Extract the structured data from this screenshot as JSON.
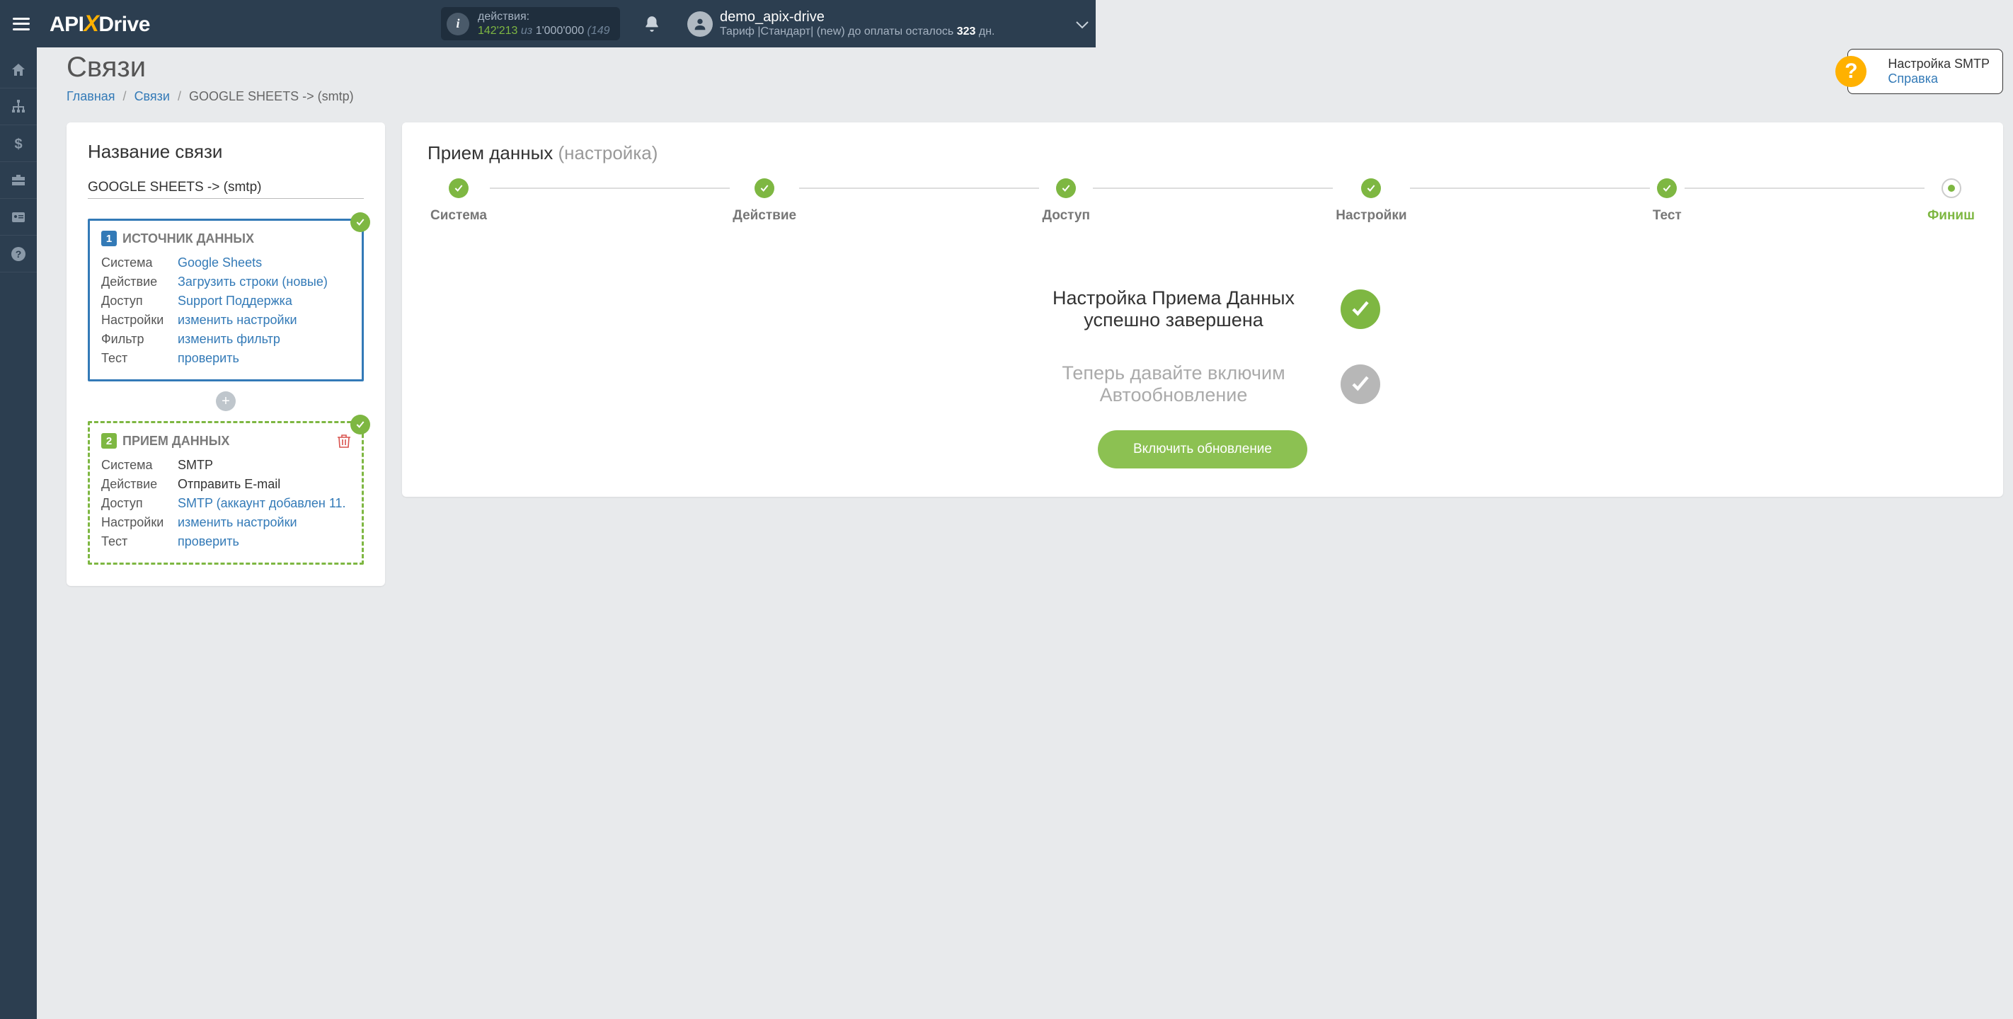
{
  "header": {
    "logo_api": "API",
    "logo_x": "X",
    "logo_drive": "Drive",
    "actions_label": "действия:",
    "actions_count": "142'213",
    "actions_of": " из ",
    "actions_limit": "1'000'000",
    "actions_extra": " (149",
    "user_name": "demo_apix-drive",
    "tariff_prefix": "Тариф |Стандарт| (new) до оплаты осталось ",
    "tariff_days": "323",
    "tariff_suffix": " дн."
  },
  "page": {
    "title": "Связи",
    "crumb_home": "Главная",
    "crumb_links": "Связи",
    "crumb_current": "GOOGLE SHEETS -> (smtp)"
  },
  "help": {
    "title": "Настройка SMTP",
    "link": "Справка"
  },
  "left": {
    "name_label": "Название связи",
    "name_value": "GOOGLE SHEETS -> (smtp)",
    "source": {
      "num": "1",
      "title": "ИСТОЧНИК ДАННЫХ",
      "rows": [
        {
          "k": "Система",
          "v": "Google Sheets"
        },
        {
          "k": "Действие",
          "v": "Загрузить строки (новые)"
        },
        {
          "k": "Доступ",
          "v": "Support Поддержка"
        },
        {
          "k": "Настройки",
          "v": "изменить настройки"
        },
        {
          "k": "Фильтр",
          "v": "изменить фильтр"
        },
        {
          "k": "Тест",
          "v": "проверить"
        }
      ]
    },
    "dest": {
      "num": "2",
      "title": "ПРИЕМ ДАННЫХ",
      "rows": [
        {
          "k": "Система",
          "v": "SMTP",
          "plain": true
        },
        {
          "k": "Действие",
          "v": "Отправить E-mail",
          "plain": true
        },
        {
          "k": "Доступ",
          "v": "SMTP (аккаунт добавлен 11."
        },
        {
          "k": "Настройки",
          "v": "изменить настройки"
        },
        {
          "k": "Тест",
          "v": "проверить"
        }
      ]
    }
  },
  "right": {
    "title": "Прием данных ",
    "title_grey": "(настройка)",
    "steps": [
      {
        "label": "Система",
        "state": "done"
      },
      {
        "label": "Действие",
        "state": "done"
      },
      {
        "label": "Доступ",
        "state": "done"
      },
      {
        "label": "Настройки",
        "state": "done"
      },
      {
        "label": "Тест",
        "state": "done"
      },
      {
        "label": "Финиш",
        "state": "current"
      }
    ],
    "status1": "Настройка Приема Данных успешно завершена",
    "status2": "Теперь давайте включим Автообновление",
    "button": "Включить обновление"
  }
}
